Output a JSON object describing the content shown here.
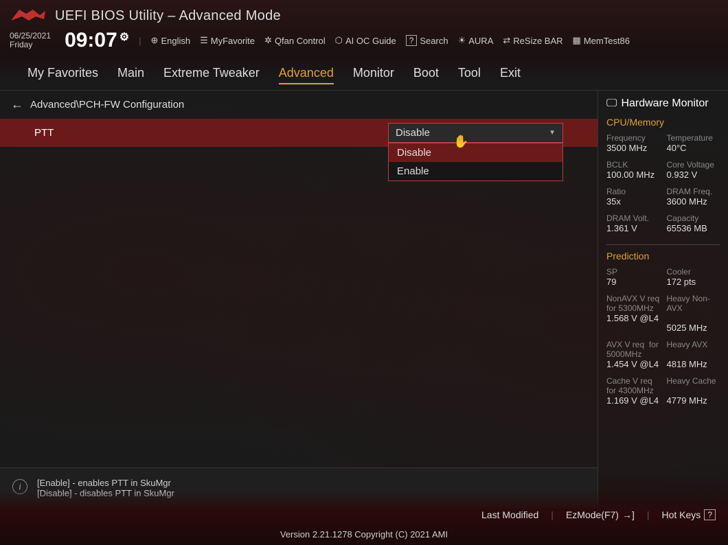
{
  "header": {
    "title": "UEFI BIOS Utility – Advanced Mode"
  },
  "datetime": {
    "date": "06/25/2021",
    "day": "Friday",
    "time": "09:07"
  },
  "toolbar": {
    "language": "English",
    "favorite": "MyFavorite",
    "qfan": "Qfan Control",
    "aioc": "AI OC Guide",
    "search": "Search",
    "aura": "AURA",
    "resize": "ReSize BAR",
    "memtest": "MemTest86"
  },
  "tabs": [
    "My Favorites",
    "Main",
    "Extreme Tweaker",
    "Advanced",
    "Monitor",
    "Boot",
    "Tool",
    "Exit"
  ],
  "active_tab": "Advanced",
  "breadcrumb": "Advanced\\PCH-FW Configuration",
  "setting": {
    "label": "PTT",
    "value": "Disable",
    "options": [
      "Disable",
      "Enable"
    ]
  },
  "help": {
    "line1": "[Enable] - enables PTT in SkuMgr",
    "line2": "[Disable] - disables PTT in SkuMgr"
  },
  "hw": {
    "title": "Hardware Monitor",
    "sections": {
      "cpu_mem": {
        "title": "CPU/Memory",
        "frequency_label": "Frequency",
        "frequency": "3500 MHz",
        "temperature_label": "Temperature",
        "temperature": "40°C",
        "bclk_label": "BCLK",
        "bclk": "100.00 MHz",
        "vcore_label": "Core Voltage",
        "vcore": "0.932 V",
        "ratio_label": "Ratio",
        "ratio": "35x",
        "dram_freq_label": "DRAM Freq.",
        "dram_freq": "3600 MHz",
        "dram_volt_label": "DRAM Volt.",
        "dram_volt": "1.361 V",
        "capacity_label": "Capacity",
        "capacity": "65536 MB"
      },
      "prediction": {
        "title": "Prediction",
        "sp_label": "SP",
        "sp": "79",
        "cooler_label": "Cooler",
        "cooler": "172 pts",
        "nonavx_label_a": "NonAVX V req",
        "nonavx_label_b": "for ",
        "nonavx_freq": "5300MHz",
        "heavy_nonavx_label": "Heavy Non-AVX",
        "nonavx_val": "1.568 V @L4",
        "heavy_nonavx_val": "5025 MHz",
        "avx_label_a": "AVX V req",
        "avx_label_b": "for ",
        "avx_freq": "5000MHz",
        "heavy_avx_label": "Heavy AVX",
        "avx_val": "1.454 V @L4",
        "heavy_avx_val": "4818 MHz",
        "cache_label_a": "Cache V req",
        "cache_label_b": "for ",
        "cache_freq": "4300MHz",
        "heavy_cache_label": "Heavy Cache",
        "cache_val": "1.169 V @L4",
        "heavy_cache_val": "4779 MHz"
      }
    }
  },
  "footer": {
    "last_modified": "Last Modified",
    "ezmode": "EzMode(F7)",
    "hotkeys": "Hot Keys",
    "version": "Version 2.21.1278 Copyright (C) 2021 AMI"
  }
}
